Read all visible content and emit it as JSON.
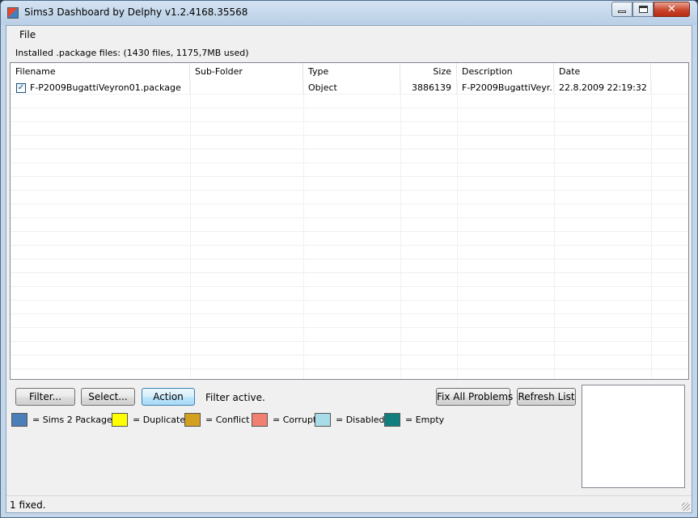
{
  "window": {
    "title": "Sims3 Dashboard by Delphy v1.2.4168.35568",
    "minimize_icon": "minimize-icon",
    "maximize_icon": "maximize-icon",
    "close_icon": "close-icon",
    "close_glyph": "✕"
  },
  "menu": {
    "file": "File"
  },
  "group_label": "Installed .package files: (1430 files, 1175,7MB used)",
  "list": {
    "columns": [
      "Filename",
      "Sub-Folder",
      "Type",
      "Size",
      "Description",
      "Date"
    ],
    "rows": [
      {
        "checked": true,
        "check_glyph": "✓",
        "filename": "F-P2009BugattiVeyron01.package",
        "subfolder": "",
        "type": "Object",
        "size": "3886139",
        "description": "F-P2009BugattiVeyr...",
        "date": "22.8.2009 22:19:32"
      }
    ]
  },
  "buttons": {
    "filter": "Filter...",
    "select": "Select...",
    "action": "Action",
    "fix_all": "Fix All Problems",
    "refresh": "Refresh List"
  },
  "filter_status": "Filter active.",
  "legend": [
    {
      "label": "= Sims 2 Package",
      "color": "#4a7fb8"
    },
    {
      "label": "= Duplicate",
      "color": "#ffff00"
    },
    {
      "label": "= Conflict",
      "color": "#d4a020"
    },
    {
      "label": "= Corrupt",
      "color": "#f28070"
    },
    {
      "label": "= Disabled",
      "color": "#a8dce8"
    },
    {
      "label": "= Empty",
      "color": "#0f7f7f"
    }
  ],
  "status": "1 fixed."
}
